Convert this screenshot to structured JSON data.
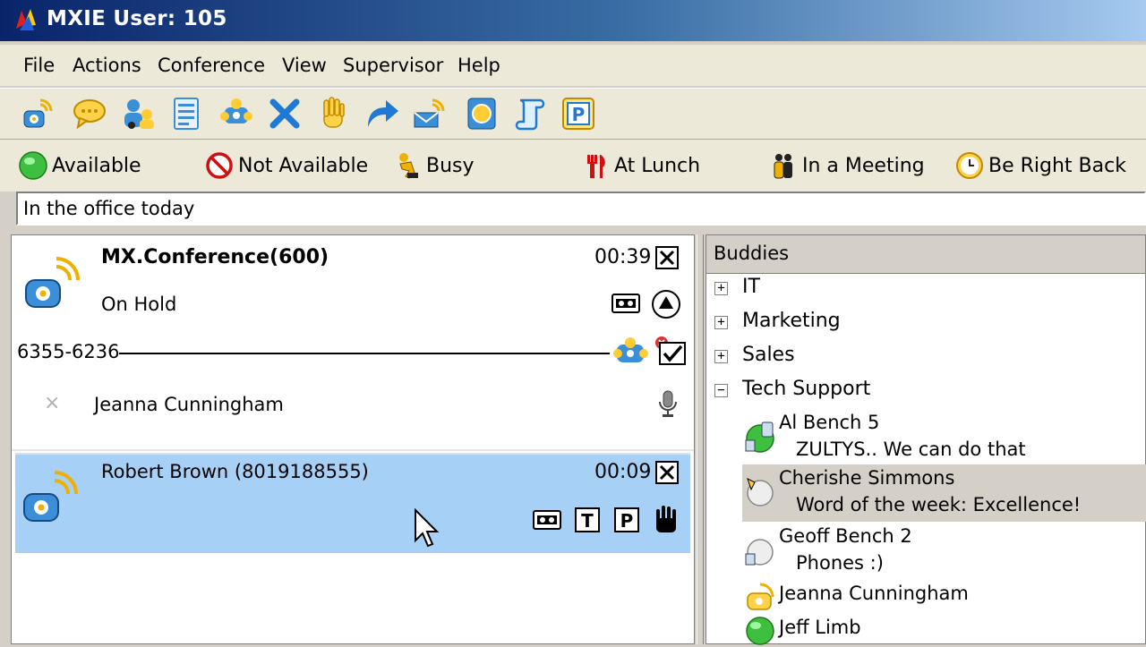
{
  "window": {
    "title": "MXIE User: 105"
  },
  "menu": [
    "File",
    "Actions",
    "Conference",
    "View",
    "Supervisor",
    "Help"
  ],
  "toolbar": {
    "buttons": [
      "phone-call-icon",
      "chat-icon",
      "contacts-icon",
      "call-log-icon",
      "conference-icon",
      "transfer-cross-icon",
      "hold-hand-icon",
      "forward-arrow-icon",
      "voicemail-icon",
      "record-icon",
      "script-scroll-icon",
      "park-icon"
    ]
  },
  "presence": {
    "items": [
      {
        "label": "Available",
        "icon": "green-circle-icon"
      },
      {
        "label": "Not Available",
        "icon": "no-entry-icon"
      },
      {
        "label": "Busy",
        "icon": "busy-runner-icon"
      },
      {
        "label": "At Lunch",
        "icon": "fork-knife-icon"
      },
      {
        "label": "In a Meeting",
        "icon": "meeting-people-icon"
      },
      {
        "label": "Be Right Back",
        "icon": "clock-icon"
      }
    ]
  },
  "status_message": {
    "value": "In the office today"
  },
  "calls": {
    "call1": {
      "name": "MX.Conference(600)",
      "state": "On Hold",
      "timer": "00:39"
    },
    "conference": {
      "number": "6355-6236",
      "participant": "Jeanna Cunningham"
    },
    "call2": {
      "name": "Robert Brown (8019188555)",
      "timer": "00:09",
      "state": ""
    },
    "colors": {
      "selected_call": "#a6d0f5",
      "title_gradient": "#0a246a"
    }
  },
  "buddies": {
    "header": "Buddies",
    "groups": [
      {
        "sign": "+",
        "name": "IT"
      },
      {
        "sign": "+",
        "name": "Marketing"
      },
      {
        "sign": "+",
        "name": "Sales"
      },
      {
        "sign": "−",
        "name": "Tech Support"
      }
    ],
    "members": [
      {
        "name": "Al Bench 5",
        "status": "ZULTYS.. We can do that"
      },
      {
        "name": "Cherishe Simmons",
        "status": "Word of the week: Excellence!"
      },
      {
        "name": "Geoff Bench 2",
        "status": "Phones :)"
      },
      {
        "name": "Jeanna Cunningham",
        "status": ""
      },
      {
        "name": "Jeff Limb",
        "status": ""
      }
    ]
  }
}
